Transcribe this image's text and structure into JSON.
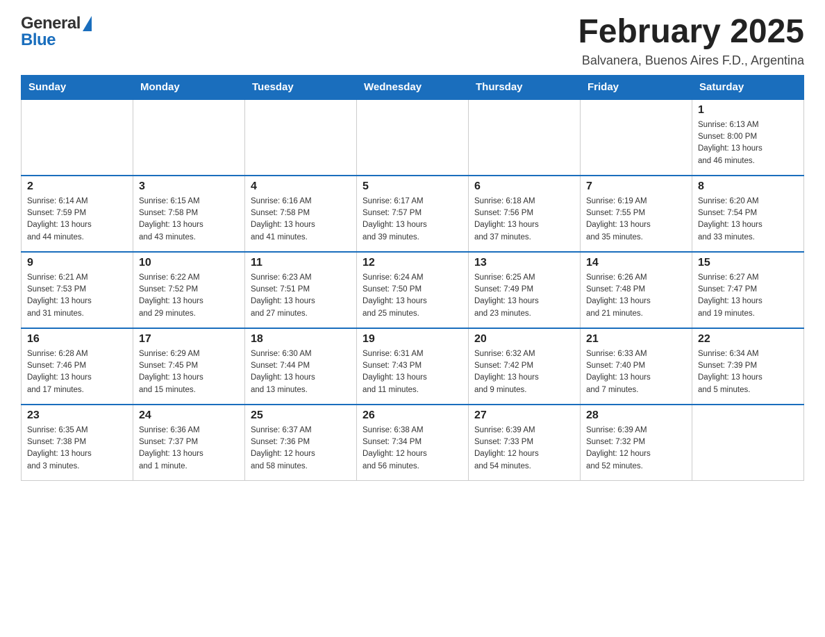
{
  "header": {
    "logo_general": "General",
    "logo_blue": "Blue",
    "title": "February 2025",
    "location": "Balvanera, Buenos Aires F.D., Argentina"
  },
  "days_of_week": [
    "Sunday",
    "Monday",
    "Tuesday",
    "Wednesday",
    "Thursday",
    "Friday",
    "Saturday"
  ],
  "weeks": [
    {
      "days": [
        {
          "number": "",
          "info": ""
        },
        {
          "number": "",
          "info": ""
        },
        {
          "number": "",
          "info": ""
        },
        {
          "number": "",
          "info": ""
        },
        {
          "number": "",
          "info": ""
        },
        {
          "number": "",
          "info": ""
        },
        {
          "number": "1",
          "info": "Sunrise: 6:13 AM\nSunset: 8:00 PM\nDaylight: 13 hours\nand 46 minutes."
        }
      ]
    },
    {
      "days": [
        {
          "number": "2",
          "info": "Sunrise: 6:14 AM\nSunset: 7:59 PM\nDaylight: 13 hours\nand 44 minutes."
        },
        {
          "number": "3",
          "info": "Sunrise: 6:15 AM\nSunset: 7:58 PM\nDaylight: 13 hours\nand 43 minutes."
        },
        {
          "number": "4",
          "info": "Sunrise: 6:16 AM\nSunset: 7:58 PM\nDaylight: 13 hours\nand 41 minutes."
        },
        {
          "number": "5",
          "info": "Sunrise: 6:17 AM\nSunset: 7:57 PM\nDaylight: 13 hours\nand 39 minutes."
        },
        {
          "number": "6",
          "info": "Sunrise: 6:18 AM\nSunset: 7:56 PM\nDaylight: 13 hours\nand 37 minutes."
        },
        {
          "number": "7",
          "info": "Sunrise: 6:19 AM\nSunset: 7:55 PM\nDaylight: 13 hours\nand 35 minutes."
        },
        {
          "number": "8",
          "info": "Sunrise: 6:20 AM\nSunset: 7:54 PM\nDaylight: 13 hours\nand 33 minutes."
        }
      ]
    },
    {
      "days": [
        {
          "number": "9",
          "info": "Sunrise: 6:21 AM\nSunset: 7:53 PM\nDaylight: 13 hours\nand 31 minutes."
        },
        {
          "number": "10",
          "info": "Sunrise: 6:22 AM\nSunset: 7:52 PM\nDaylight: 13 hours\nand 29 minutes."
        },
        {
          "number": "11",
          "info": "Sunrise: 6:23 AM\nSunset: 7:51 PM\nDaylight: 13 hours\nand 27 minutes."
        },
        {
          "number": "12",
          "info": "Sunrise: 6:24 AM\nSunset: 7:50 PM\nDaylight: 13 hours\nand 25 minutes."
        },
        {
          "number": "13",
          "info": "Sunrise: 6:25 AM\nSunset: 7:49 PM\nDaylight: 13 hours\nand 23 minutes."
        },
        {
          "number": "14",
          "info": "Sunrise: 6:26 AM\nSunset: 7:48 PM\nDaylight: 13 hours\nand 21 minutes."
        },
        {
          "number": "15",
          "info": "Sunrise: 6:27 AM\nSunset: 7:47 PM\nDaylight: 13 hours\nand 19 minutes."
        }
      ]
    },
    {
      "days": [
        {
          "number": "16",
          "info": "Sunrise: 6:28 AM\nSunset: 7:46 PM\nDaylight: 13 hours\nand 17 minutes."
        },
        {
          "number": "17",
          "info": "Sunrise: 6:29 AM\nSunset: 7:45 PM\nDaylight: 13 hours\nand 15 minutes."
        },
        {
          "number": "18",
          "info": "Sunrise: 6:30 AM\nSunset: 7:44 PM\nDaylight: 13 hours\nand 13 minutes."
        },
        {
          "number": "19",
          "info": "Sunrise: 6:31 AM\nSunset: 7:43 PM\nDaylight: 13 hours\nand 11 minutes."
        },
        {
          "number": "20",
          "info": "Sunrise: 6:32 AM\nSunset: 7:42 PM\nDaylight: 13 hours\nand 9 minutes."
        },
        {
          "number": "21",
          "info": "Sunrise: 6:33 AM\nSunset: 7:40 PM\nDaylight: 13 hours\nand 7 minutes."
        },
        {
          "number": "22",
          "info": "Sunrise: 6:34 AM\nSunset: 7:39 PM\nDaylight: 13 hours\nand 5 minutes."
        }
      ]
    },
    {
      "days": [
        {
          "number": "23",
          "info": "Sunrise: 6:35 AM\nSunset: 7:38 PM\nDaylight: 13 hours\nand 3 minutes."
        },
        {
          "number": "24",
          "info": "Sunrise: 6:36 AM\nSunset: 7:37 PM\nDaylight: 13 hours\nand 1 minute."
        },
        {
          "number": "25",
          "info": "Sunrise: 6:37 AM\nSunset: 7:36 PM\nDaylight: 12 hours\nand 58 minutes."
        },
        {
          "number": "26",
          "info": "Sunrise: 6:38 AM\nSunset: 7:34 PM\nDaylight: 12 hours\nand 56 minutes."
        },
        {
          "number": "27",
          "info": "Sunrise: 6:39 AM\nSunset: 7:33 PM\nDaylight: 12 hours\nand 54 minutes."
        },
        {
          "number": "28",
          "info": "Sunrise: 6:39 AM\nSunset: 7:32 PM\nDaylight: 12 hours\nand 52 minutes."
        },
        {
          "number": "",
          "info": ""
        }
      ]
    }
  ]
}
